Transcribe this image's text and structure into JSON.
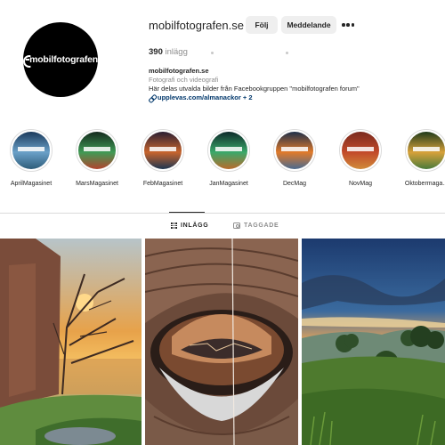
{
  "profile": {
    "avatar_text": "mobilfotografen",
    "username": "mobilfotografen.se",
    "follow_label": "Följ",
    "message_label": "Meddelande",
    "more_icon": "more-horizontal-icon",
    "posts_count": "390",
    "posts_label": "inlägg"
  },
  "bio": {
    "name": "mobilfotografen.se",
    "category": "Fotografi och videografi",
    "description": "Här delas utvalda bilder från Facebookgruppen \"mobilfotografen forum\"",
    "link": "upplevas.com/almanackor + 2",
    "link_icon": "link-icon"
  },
  "highlights": [
    {
      "label": "AprilMagasinet",
      "colors": [
        "#1b3a5c",
        "#6aa0c8",
        "#2e5d7a"
      ]
    },
    {
      "label": "MarsMagasinet",
      "colors": [
        "#142a1e",
        "#3f9a55",
        "#b2452e"
      ]
    },
    {
      "label": "FebMagasinet",
      "colors": [
        "#2a1f33",
        "#c7642d",
        "#1e3550"
      ]
    },
    {
      "label": "JanMagasinet",
      "colors": [
        "#0d2a2a",
        "#3aa86a",
        "#b96b2c"
      ]
    },
    {
      "label": "DecMag",
      "colors": [
        "#1e2f4a",
        "#e07a2a",
        "#4b6a8e"
      ]
    },
    {
      "label": "NovMag",
      "colors": [
        "#7a2a1e",
        "#c24a2a",
        "#d08a3a"
      ]
    },
    {
      "label": "Oktobermaga...",
      "colors": [
        "#1f3a1a",
        "#d7a13a",
        "#4a7a3a"
      ]
    }
  ],
  "tabs": {
    "posts": "INLÄGG",
    "tagged": "TAGGADE",
    "posts_icon": "grid-icon",
    "tagged_icon": "tag-icon"
  },
  "colors": {
    "link": "#00376b",
    "button_bg": "#efefef",
    "secondary_text": "#8e8e8e",
    "divider": "#dbdbdb"
  }
}
